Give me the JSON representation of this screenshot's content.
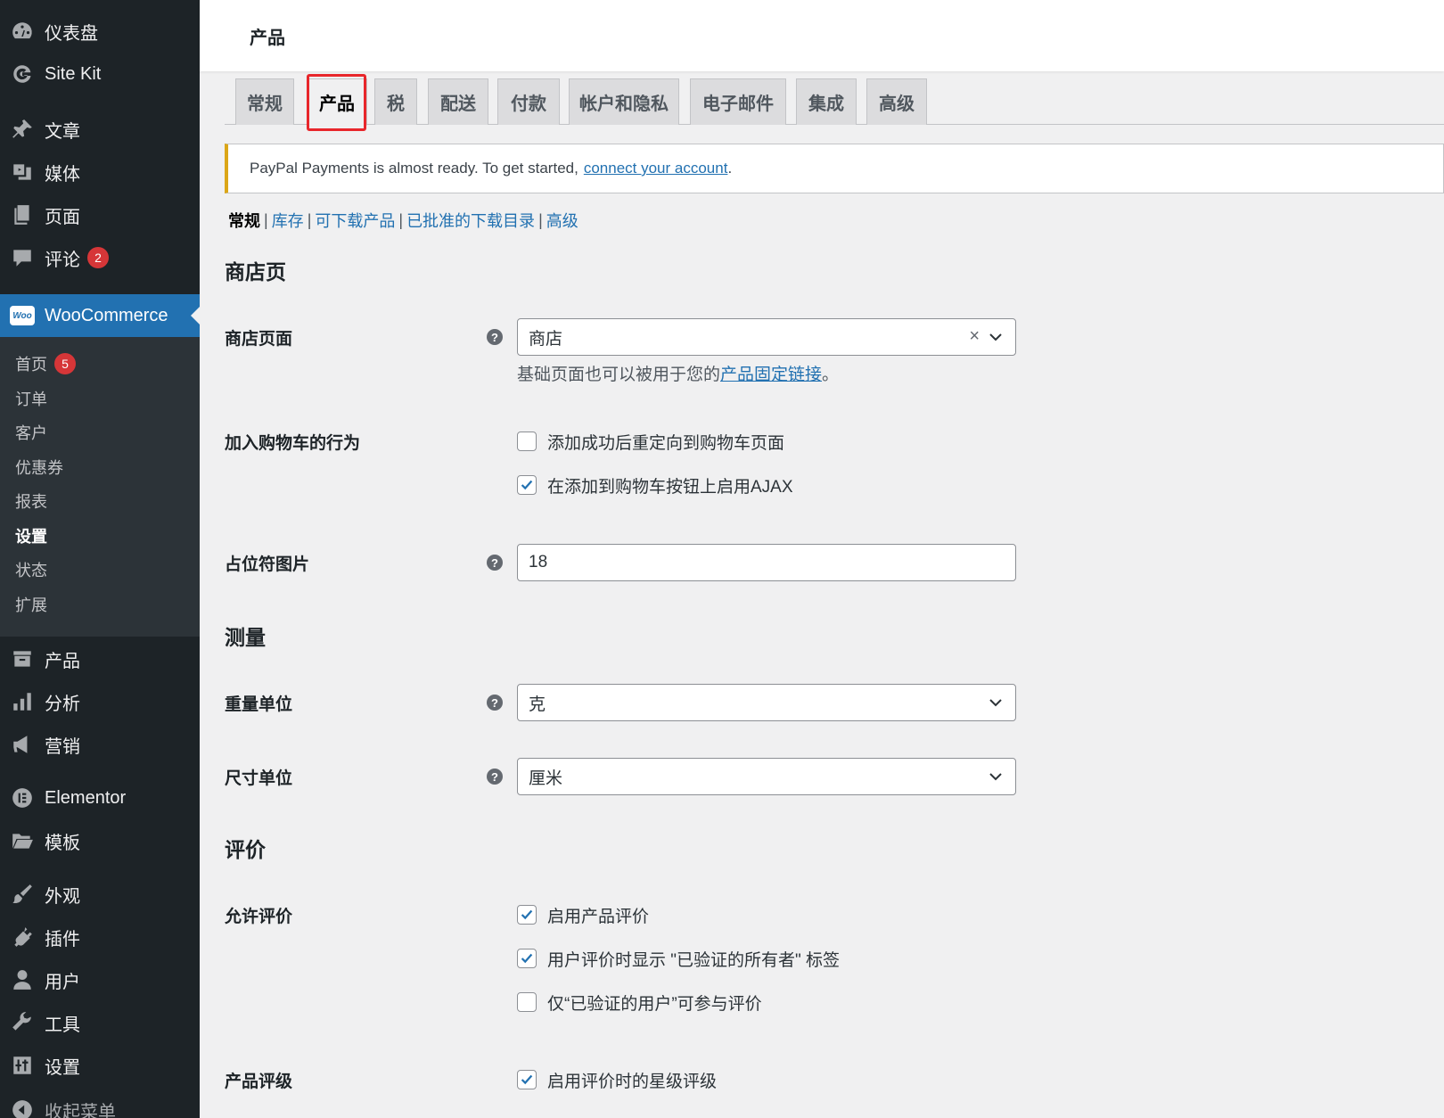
{
  "sidebar": {
    "items_top": [
      {
        "label": "仪表盘",
        "icon": "dashboard-icon"
      },
      {
        "label": "Site Kit",
        "icon": "google-g-icon"
      },
      {
        "label": "文章",
        "icon": "pin-icon"
      },
      {
        "label": "媒体",
        "icon": "media-icon"
      },
      {
        "label": "页面",
        "icon": "pages-icon"
      },
      {
        "label": "评论",
        "icon": "comment-icon",
        "badge": "2"
      }
    ],
    "woocommerce": {
      "label": "WooCommerce",
      "logo": "Woo"
    },
    "submenu": [
      {
        "label": "首页",
        "badge": "5"
      },
      {
        "label": "订单"
      },
      {
        "label": "客户"
      },
      {
        "label": "优惠券"
      },
      {
        "label": "报表"
      },
      {
        "label": "设置",
        "current": true
      },
      {
        "label": "状态"
      },
      {
        "label": "扩展"
      }
    ],
    "items_bottom": [
      {
        "label": "产品",
        "icon": "archive-icon"
      },
      {
        "label": "分析",
        "icon": "chart-bar-icon"
      },
      {
        "label": "营销",
        "icon": "megaphone-icon"
      },
      {
        "label": "Elementor",
        "icon": "elementor-icon"
      },
      {
        "label": "模板",
        "icon": "folder-icon"
      },
      {
        "label": "外观",
        "icon": "brush-icon"
      },
      {
        "label": "插件",
        "icon": "plugin-icon"
      },
      {
        "label": "用户",
        "icon": "user-icon"
      },
      {
        "label": "工具",
        "icon": "wrench-icon"
      },
      {
        "label": "设置",
        "icon": "settings-icon"
      },
      {
        "label": "收起菜单",
        "icon": "collapse-icon"
      }
    ]
  },
  "header": {
    "title": "产品"
  },
  "tabs": [
    "常规",
    "产品",
    "税",
    "配送",
    "付款",
    "帐户和隐私",
    "电子邮件",
    "集成",
    "高级"
  ],
  "active_tab": "产品",
  "notice": {
    "text": "PayPal Payments is almost ready. To get started,",
    "link": "connect your account",
    "suffix": "."
  },
  "subnav": {
    "current": "常规",
    "links": [
      "库存",
      "可下载产品",
      "已批准的下载目录",
      "高级"
    ],
    "sep": "|"
  },
  "form": {
    "shop_section": "商店页",
    "shop_page_label": "商店页面",
    "shop_page_value": "商店",
    "shop_page_clear": "×",
    "shop_page_desc": "基础页面也可以被用于您的",
    "shop_page_desc_link": "产品固定链接",
    "shop_page_desc_end": "。",
    "cart_label": "加入购物车的行为",
    "cart_redirect": {
      "label": "添加成功后重定向到购物车页面",
      "checked": false
    },
    "cart_ajax": {
      "label": "在添加到购物车按钮上启用AJAX",
      "checked": true
    },
    "placeholder_label": "占位符图片",
    "placeholder_value": "18",
    "measure_section": "测量",
    "weight_label": "重量单位",
    "weight_value": "克",
    "dimension_label": "尺寸单位",
    "dimension_value": "厘米",
    "reviews_section": "评价",
    "allow_reviews_label": "允许评价",
    "enable_reviews": {
      "label": "启用产品评价",
      "checked": true
    },
    "verified_label": {
      "label": "用户评价时显示 \"已验证的所有者\" 标签",
      "checked": true
    },
    "verified_only": {
      "label": "仅“已验证的用户”可参与评价",
      "checked": false
    },
    "rating_label": "产品评级",
    "enable_star": {
      "label": "启用评价时的星级评级",
      "checked": true
    },
    "help_glyph": "?"
  },
  "colors": {
    "accent": "#2271b1",
    "sidebar": "#1d2327",
    "highlight": "#e8262b",
    "badge": "#d63638"
  }
}
